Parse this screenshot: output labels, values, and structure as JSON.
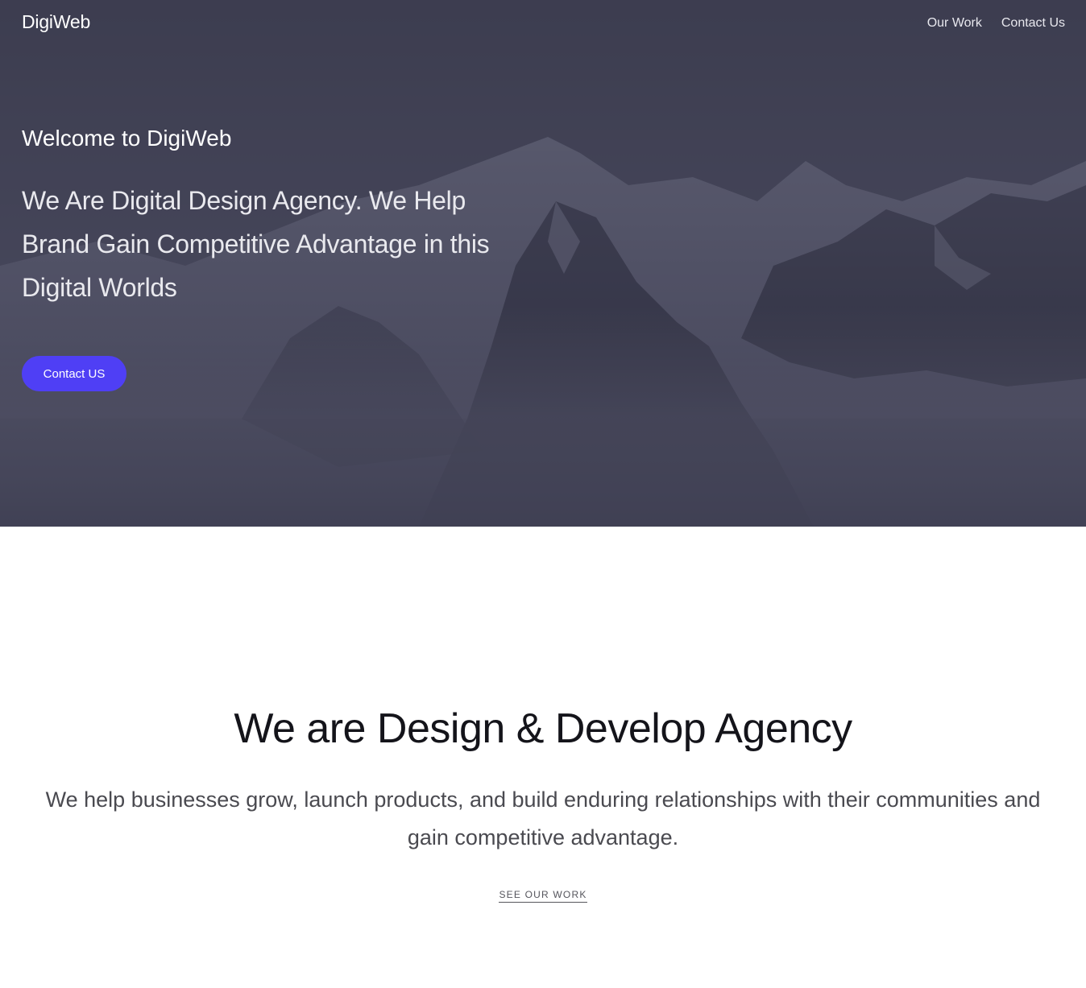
{
  "colors": {
    "hero_overlay": "#3a3a4e",
    "cta_background": "#4f3ff5",
    "heading_text": "#14141a",
    "body_text": "#4a4a50"
  },
  "nav": {
    "brand": "DigiWeb",
    "links": [
      {
        "label": "Our Work"
      },
      {
        "label": "Contact Us"
      }
    ]
  },
  "hero": {
    "background": "snowy-mountain-range-photo",
    "welcome": "Welcome to DigiWeb",
    "tagline_lines": [
      "We Are Digital Design Agency. We Help",
      "Brand Gain Competitive Advantage in this",
      "Digital Worlds"
    ],
    "cta_label": "Contact US"
  },
  "about": {
    "title": "We are Design & Develop Agency",
    "text_lines": [
      "We help businesses grow, launch products, and build enduring relationships with their communities and",
      "gain competitive advantage."
    ],
    "link_label": "SEE OUR WORK"
  }
}
